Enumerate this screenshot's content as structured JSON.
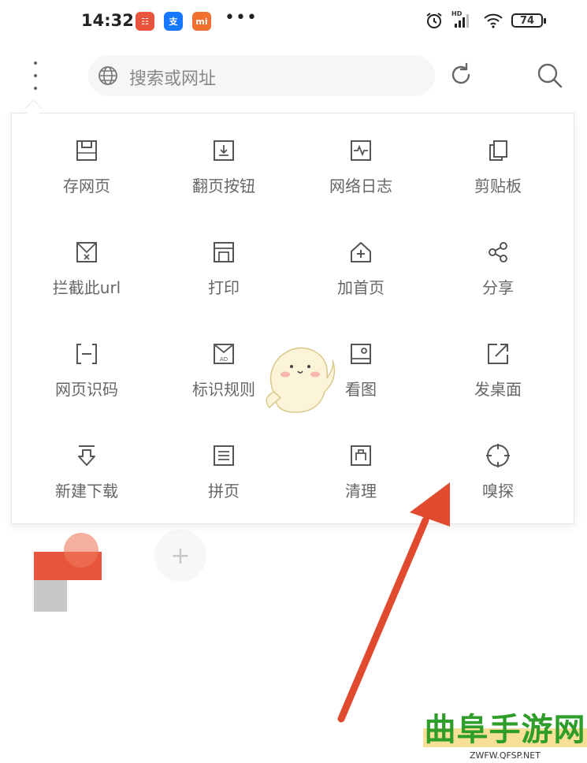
{
  "status_bar": {
    "time": "14:32",
    "app_badges": [
      {
        "name": "app-badge-1",
        "text": "☷",
        "color": "#e8553c"
      },
      {
        "name": "alipay-badge",
        "text": "支",
        "color": "#1677ff"
      },
      {
        "name": "mi-badge",
        "text": "mi",
        "color": "#f07030"
      }
    ],
    "more": "•••",
    "hd_label": "HD",
    "battery": "74"
  },
  "address_bar": {
    "placeholder": "搜索或网址"
  },
  "menu": {
    "items": [
      {
        "label": "存网页",
        "icon": "save-page-icon"
      },
      {
        "label": "翻页按钮",
        "icon": "page-turn-icon"
      },
      {
        "label": "网络日志",
        "icon": "network-log-icon"
      },
      {
        "label": "剪贴板",
        "icon": "clipboard-icon"
      },
      {
        "label": "拦截此url",
        "icon": "block-url-icon"
      },
      {
        "label": "打印",
        "icon": "print-icon"
      },
      {
        "label": "加首页",
        "icon": "add-home-icon"
      },
      {
        "label": "分享",
        "icon": "share-icon"
      },
      {
        "label": "网页识码",
        "icon": "scan-code-icon"
      },
      {
        "label": "标识规则",
        "icon": "ad-rule-icon"
      },
      {
        "label": "看图",
        "icon": "view-image-icon"
      },
      {
        "label": "发桌面",
        "icon": "send-desktop-icon"
      },
      {
        "label": "新建下载",
        "icon": "new-download-icon"
      },
      {
        "label": "拼页",
        "icon": "merge-pages-icon"
      },
      {
        "label": "清理",
        "icon": "clean-icon"
      },
      {
        "label": "嗅探",
        "icon": "sniff-icon"
      }
    ]
  },
  "shortcuts": {
    "add": "+"
  },
  "watermark": {
    "title": "曲阜手游网",
    "url": "ZWFW.QFSP.NET"
  },
  "colors": {
    "arrow": "#e04a2f",
    "watermark_green": "#2e9d2a",
    "shortcut_red": "#e8553c"
  }
}
